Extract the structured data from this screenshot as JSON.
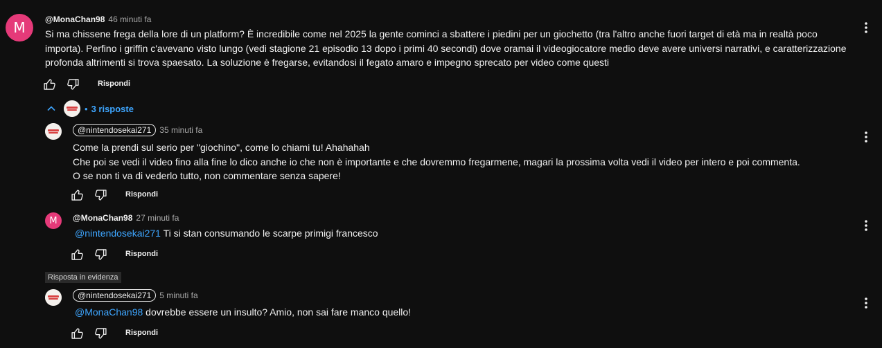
{
  "comment": {
    "author": "@MonaChan98",
    "avatar_letter": "M",
    "time": "46 minuti fa",
    "lines": [
      "Si ma chissene frega della lore di un platform? È incredibile come nel 2025 la gente cominci a sbattere i piedini per un giochetto (tra l'altro anche fuori target di età ma in realtà poco",
      "importa). Perfino i griffin c'avevano visto lungo (vedi stagione 21 episodio 13 dopo i primi 40 secondi) dove oramai il videogiocatore medio deve avere universi narrativi, e caratterizzazione",
      "profonda altrimenti si trova spaesato. La soluzione è fregarse, evitandosi il fegato amaro e impegno sprecato per video come questi"
    ],
    "reply_label": "Rispondi"
  },
  "replies_toggle": {
    "bullet": "•",
    "count_label": "3 risposte"
  },
  "replies": [
    {
      "author": "@nintendosekai271",
      "time": "35 minuti fa",
      "lines": [
        "Come la prendi sul serio per \"giochino\", come lo chiami tu! Ahahahah",
        "Che poi se vedi il video fino alla fine lo dico anche io che non è importante e che dovremmo fregarmene, magari la prossima volta vedi il video per intero e poi commenta.",
        "O se non ti va di vederlo tutto, non commentare senza sapere!"
      ],
      "reply_label": "Rispondi"
    },
    {
      "author": "@MonaChan98",
      "avatar_letter": "M",
      "time": "27 minuti fa",
      "mention": "@nintendosekai271",
      "text": " Ti si stan consumando le scarpe primigi francesco",
      "reply_label": "Rispondi"
    },
    {
      "badge": "Risposta in evidenza",
      "author": "@nintendosekai271",
      "time": "5 minuti fa",
      "mention": "@MonaChan98",
      "text": " dovrebbe essere un insulto? Amio, non sai fare manco quello!",
      "reply_label": "Rispondi"
    }
  ],
  "colors": {
    "background": "#0f0f0f",
    "text": "#f1f1f1",
    "muted": "#aaaaaa",
    "link": "#3ea6ff",
    "avatar_pink": "#e53a79"
  },
  "icons": [
    "thumb-up-icon",
    "thumb-down-icon",
    "more-vert-icon",
    "chevron-up-icon"
  ]
}
